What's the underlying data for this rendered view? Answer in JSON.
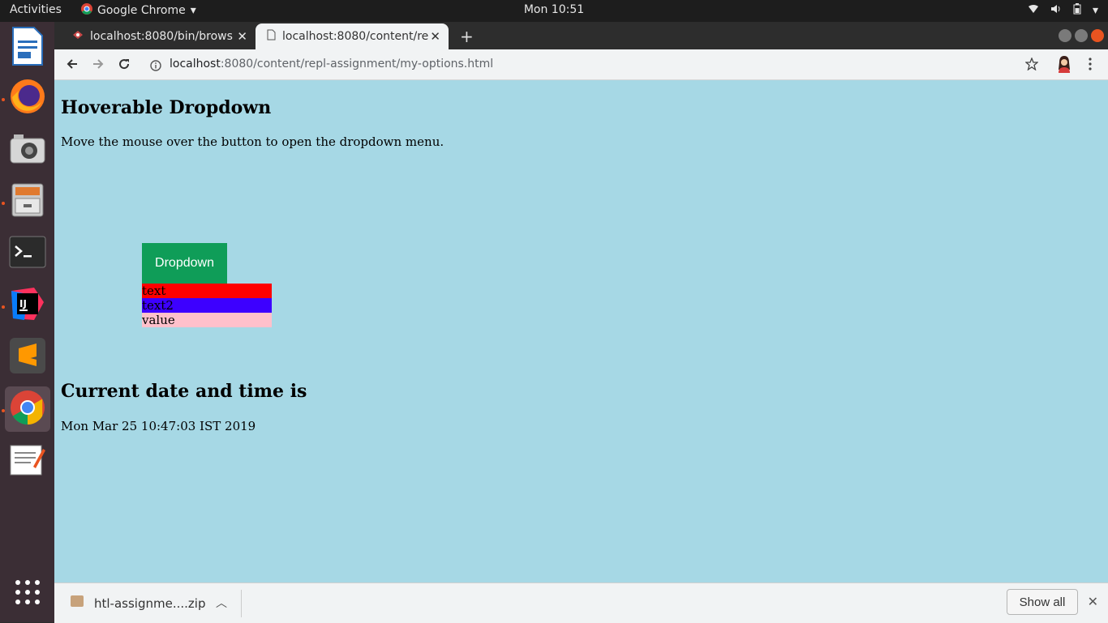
{
  "topbar": {
    "activities": "Activities",
    "app_name": "Google Chrome",
    "clock": "Mon 10:51"
  },
  "dock": {
    "items": [
      {
        "icon": "libreoffice-writer-icon"
      },
      {
        "icon": "firefox-icon"
      },
      {
        "icon": "camera-icon"
      },
      {
        "icon": "file-manager-icon"
      },
      {
        "icon": "terminal-icon"
      },
      {
        "icon": "intellij-idea-icon"
      },
      {
        "icon": "sublime-text-icon"
      },
      {
        "icon": "chrome-icon"
      },
      {
        "icon": "text-editor-icon"
      },
      {
        "icon": "app-grid-icon"
      }
    ]
  },
  "browser": {
    "tabs": [
      {
        "title": "localhost:8080/bin/brows",
        "close": "✕"
      },
      {
        "title": "localhost:8080/content/re",
        "close": "✕"
      }
    ],
    "new_tab": "+",
    "url_host": "localhost",
    "url_rest": ":8080/content/repl-assignment/my-options.html"
  },
  "page": {
    "heading": "Hoverable Dropdown",
    "description": "Move the mouse over the button to open the dropdown menu.",
    "dropdown_button": "Dropdown",
    "options": [
      "text",
      "text2",
      "value"
    ],
    "datetime_heading": "Current date and time is",
    "datetime_value": "Mon Mar 25 10:47:03 IST 2019"
  },
  "download_bar": {
    "filename": "htl-assignme....zip",
    "show_all": "Show all",
    "close": "✕"
  },
  "colors": {
    "page_background": "#a6d8e5",
    "dropdown_button": "#0f9d58",
    "option_text": "#ff0000",
    "option_text2": "#3d00ff",
    "option_value": "#ffc0cb"
  }
}
